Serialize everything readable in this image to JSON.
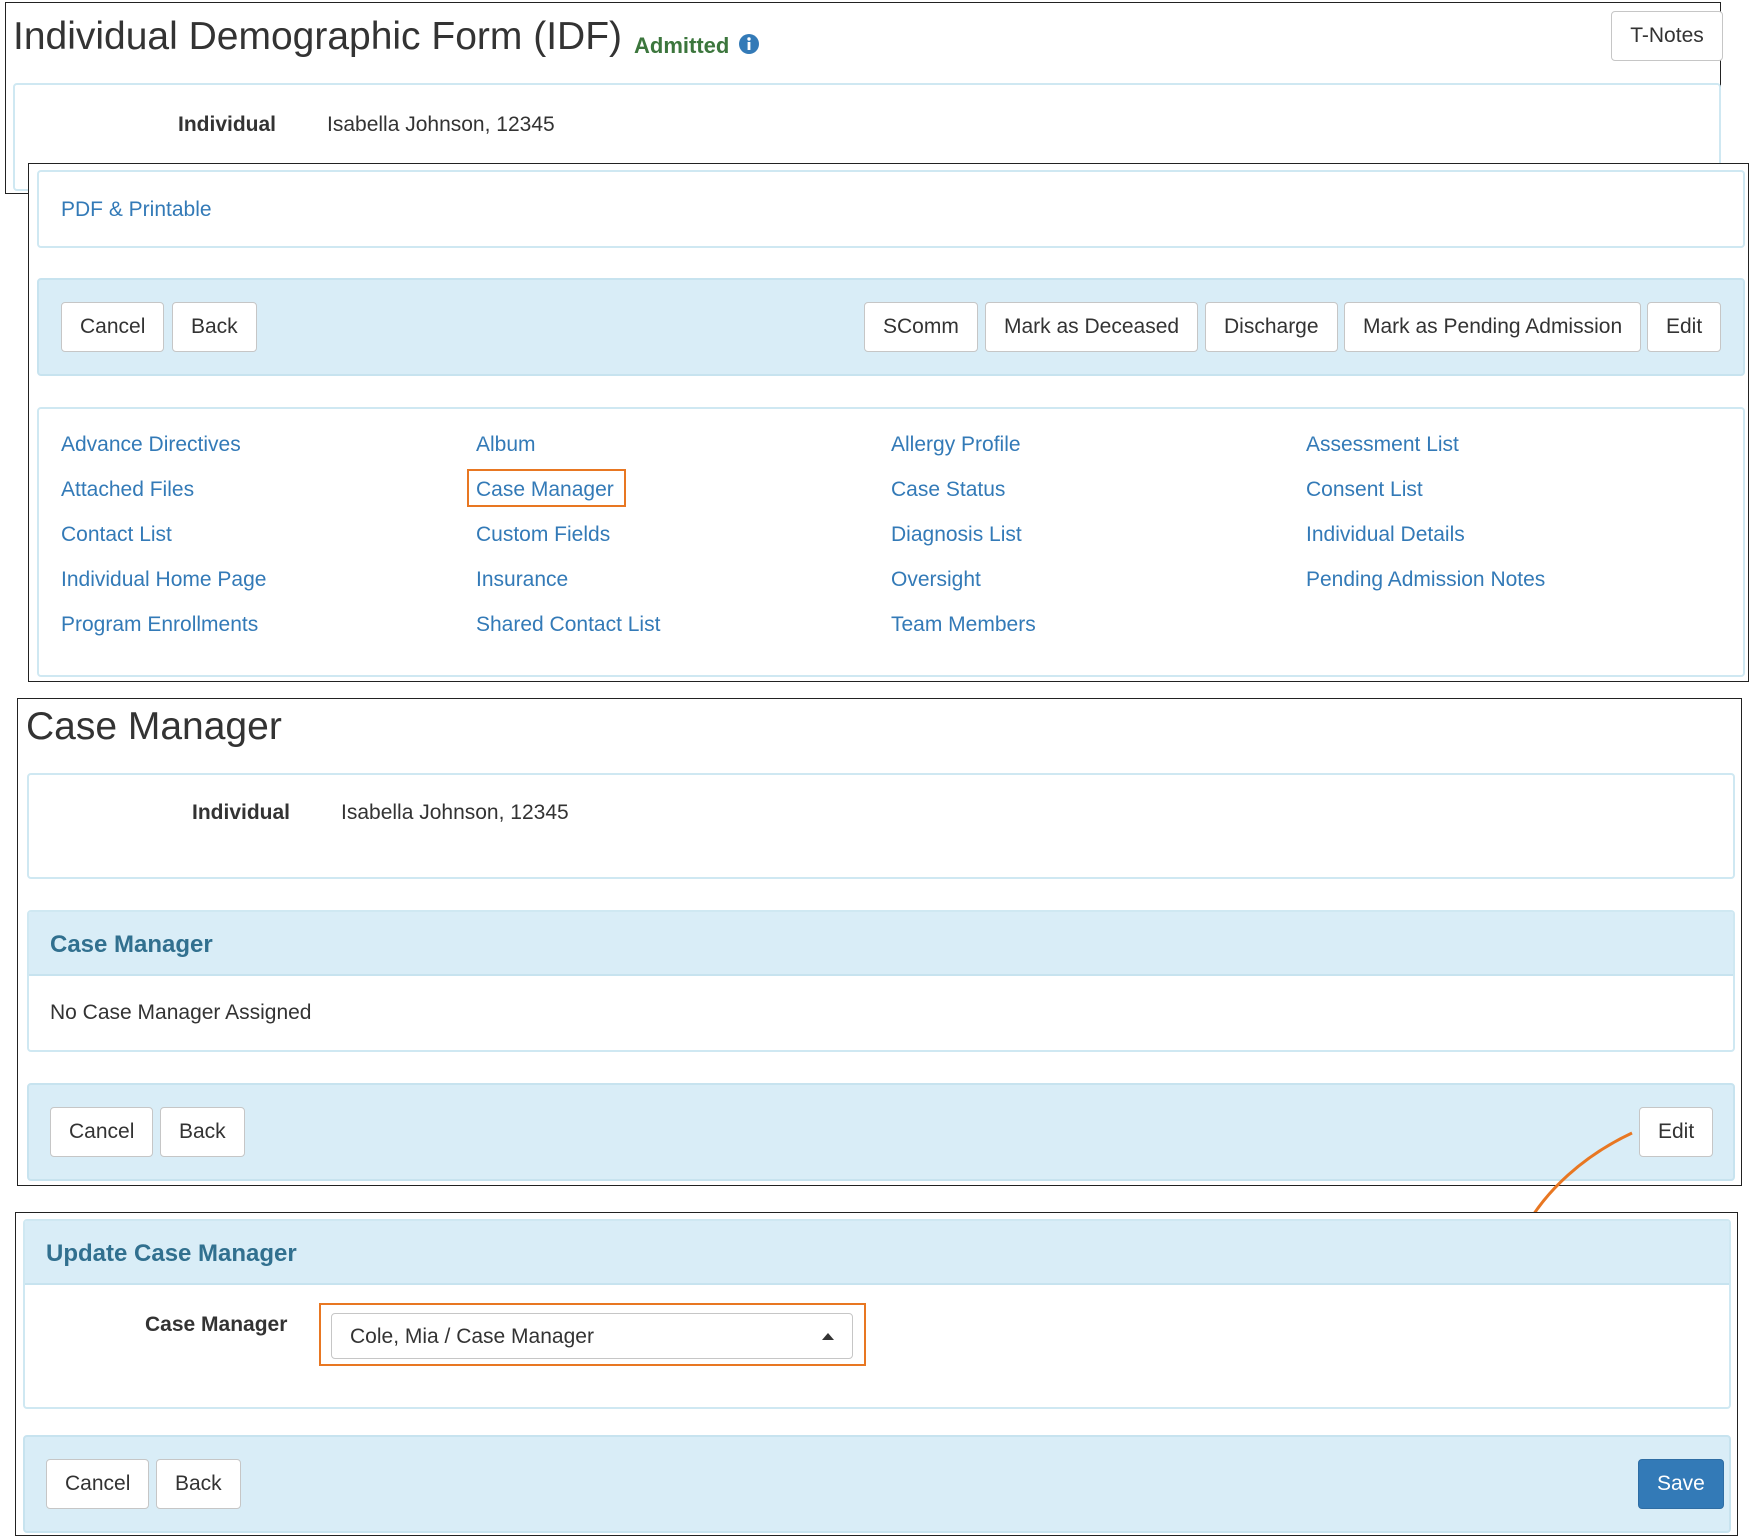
{
  "idf": {
    "title": "Individual Demographic Form (IDF)",
    "status": "Admitted",
    "info_icon": "info-circle-icon",
    "tnotes_label": "T-Notes",
    "individual_label": "Individual",
    "individual_value": "Isabella Johnson, 12345",
    "pdf_link": "PDF & Printable",
    "actions": {
      "cancel": "Cancel",
      "back": "Back",
      "scomm": "SComm",
      "deceased": "Mark as Deceased",
      "discharge": "Discharge",
      "pending": "Mark as Pending Admission",
      "edit": "Edit"
    },
    "links": [
      "Advance Directives",
      "Album",
      "Allergy Profile",
      "Assessment List",
      "Attached Files",
      "Case Manager",
      "Case Status",
      "Consent List",
      "Contact List",
      "Custom Fields",
      "Diagnosis List",
      "Individual Details",
      "Individual Home Page",
      "Insurance",
      "Oversight",
      "Pending Admission Notes",
      "Program Enrollments",
      "Shared Contact List",
      "Team Members"
    ]
  },
  "case_manager_page": {
    "title": "Case Manager",
    "individual_label": "Individual",
    "individual_value": "Isabella Johnson, 12345",
    "section_title": "Case Manager",
    "section_body": "No Case Manager Assigned",
    "cancel": "Cancel",
    "back": "Back",
    "edit": "Edit"
  },
  "update_form": {
    "title": "Update Case Manager",
    "field_label": "Case Manager",
    "selected_value": "Cole, Mia / Case Manager",
    "cancel": "Cancel",
    "back": "Back",
    "save": "Save"
  },
  "colors": {
    "link": "#337ab7",
    "status_green": "#3c763d",
    "highlight": "#e87722",
    "bar_bg": "#d9edf7",
    "primary": "#337ab7"
  }
}
